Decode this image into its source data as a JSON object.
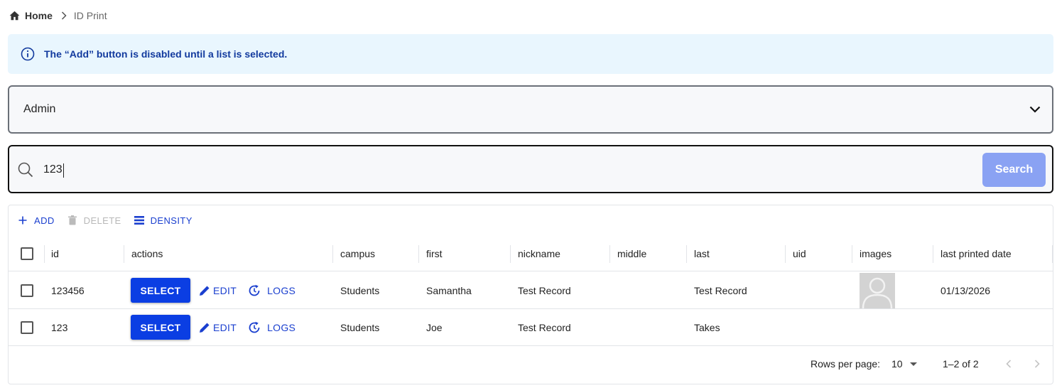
{
  "breadcrumb": {
    "home": "Home",
    "current": "ID Print"
  },
  "info": {
    "message": "The “Add” button is disabled until a list is selected."
  },
  "list_select": {
    "value": "Admin"
  },
  "search": {
    "value": "123",
    "button_label": "Search"
  },
  "toolbar": {
    "add_label": "ADD",
    "delete_label": "DELETE",
    "density_label": "DENSITY"
  },
  "columns": [
    "id",
    "actions",
    "campus",
    "first",
    "nickname",
    "middle",
    "last",
    "uid",
    "images",
    "last printed date"
  ],
  "actions": {
    "select_label": "SELECT",
    "edit_label": "EDIT",
    "logs_label": "LOGS"
  },
  "rows": [
    {
      "id": "123456",
      "campus": "Students",
      "first": "Samantha",
      "nickname": "Test Record",
      "middle": "",
      "last": "Test Record",
      "uid": "",
      "has_image": true,
      "last_printed_date": "01/13/2026"
    },
    {
      "id": "123",
      "campus": "Students",
      "first": "Joe",
      "nickname": "Test Record",
      "middle": "",
      "last": "Takes",
      "uid": "",
      "has_image": false,
      "last_printed_date": ""
    }
  ],
  "pagination": {
    "rows_per_page_label": "Rows per page:",
    "rows_per_page": "10",
    "range": "1–2 of 2"
  },
  "colors": {
    "primary": "#0b3ee3",
    "link": "#1a3fcf",
    "info_bg": "#e9f6fe",
    "info_text": "#123a9e",
    "search_button": "#8aa2f3"
  }
}
